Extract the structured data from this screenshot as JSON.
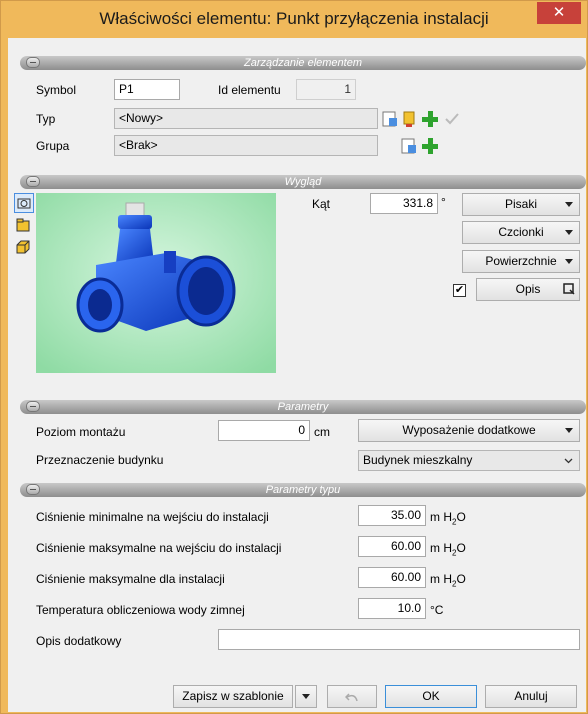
{
  "window": {
    "title": "Właściwości elementu: Punkt przyłączenia instalacji",
    "close_glyph": "✕"
  },
  "sections": {
    "management": "Zarządzanie elementem",
    "appearance": "Wygląd",
    "parameters": "Parametry",
    "type_parameters": "Parametry typu"
  },
  "management": {
    "symbol_label": "Symbol",
    "symbol_value": "P1",
    "id_label": "Id elementu",
    "id_value": "1",
    "type_label": "Typ",
    "type_value": "<Nowy>",
    "group_label": "Grupa",
    "group_value": "<Brak>"
  },
  "appearance": {
    "angle_label": "Kąt",
    "angle_value": "331.8",
    "angle_unit": "°",
    "pens_label": "Pisaki",
    "fonts_label": "Czcionki",
    "surfaces_label": "Powierzchnie",
    "desc_label": "Opis",
    "desc_checked": true
  },
  "parameters": {
    "mount_label": "Poziom montażu",
    "mount_value": "0",
    "mount_unit": "cm",
    "equipment_label": "Wyposażenie dodatkowe",
    "purpose_label": "Przeznaczenie budynku",
    "purpose_value": "Budynek mieszkalny"
  },
  "type_parameters": {
    "rows": [
      {
        "label": "Ciśnienie minimalne na wejściu do instalacji",
        "value": "35.00",
        "unit": "m H",
        "sub": "2",
        "tail": "O"
      },
      {
        "label": "Ciśnienie maksymalne na wejściu do instalacji",
        "value": "60.00",
        "unit": "m H",
        "sub": "2",
        "tail": "O"
      },
      {
        "label": "Ciśnienie maksymalne dla instalacji",
        "value": "60.00",
        "unit": "m H",
        "sub": "2",
        "tail": "O"
      },
      {
        "label": "Temperatura obliczeniowa wody zimnej",
        "value": "10.0",
        "unit": "°C",
        "sub": "",
        "tail": ""
      }
    ],
    "extra_label": "Opis dodatkowy",
    "extra_value": ""
  },
  "footer": {
    "save_template": "Zapisz w szablonie",
    "ok": "OK",
    "cancel": "Anuluj"
  },
  "colors": {
    "title_bar": "#f0b95b",
    "close": "#c7413a",
    "plus": "#2ea32e",
    "valve": "#1e5de8",
    "preview_bg": "#b6e9c4"
  },
  "icons": [
    "close-icon",
    "edit-icon",
    "bookmark-icon",
    "plus-icon",
    "check-icon",
    "view-3d-icon",
    "view-side-icon",
    "view-box-icon",
    "window-icon",
    "undo-icon"
  ]
}
